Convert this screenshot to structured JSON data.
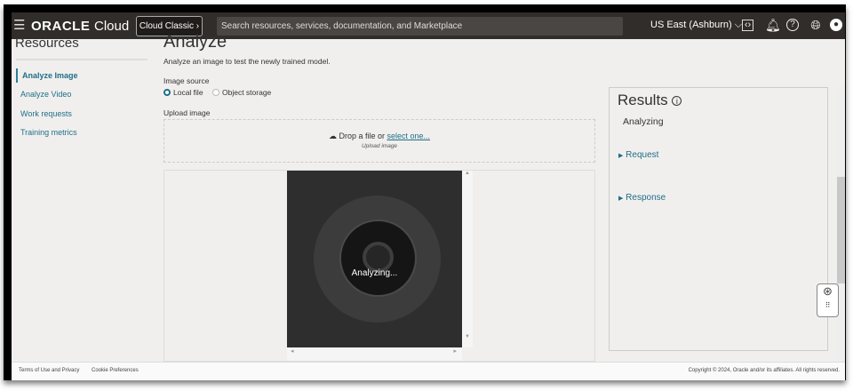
{
  "header": {
    "menu_icon": "hamburger-icon",
    "logo": "ORACLE",
    "logo_suffix": "Cloud",
    "classic_button": "Cloud Classic ›",
    "search_placeholder": "Search resources, services, documentation, and Marketplace",
    "region": "US East (Ashburn) ⌵"
  },
  "sidebar": {
    "title": "Resources",
    "items": [
      {
        "label": "Analyze Image",
        "active": true
      },
      {
        "label": "Analyze Video"
      },
      {
        "label": "Work requests"
      },
      {
        "label": "Training metrics"
      }
    ]
  },
  "main": {
    "title": "Analyze",
    "description": "Analyze an image to test the newly trained model.",
    "image_source_label": "Image source",
    "options": [
      "Local file",
      "Object storage"
    ],
    "selected_option": "Local file",
    "upload_label": "Upload image",
    "drop_text": "Drop a file or ",
    "drop_link": "select one...",
    "drop_sub": "Upload image",
    "overlay_text": "Analyzing..."
  },
  "results": {
    "title": "Results",
    "status": "Analyzing",
    "request": "Request",
    "response": "Response"
  },
  "footer": {
    "terms": "Terms of Use and Privacy",
    "cookies": "Cookie Preferences",
    "copyright": "Copyright © 2024, Oracle and/or its affiliates. All rights reserved."
  },
  "colors": {
    "header": "#312d2a",
    "link": "#1e6f8a"
  }
}
